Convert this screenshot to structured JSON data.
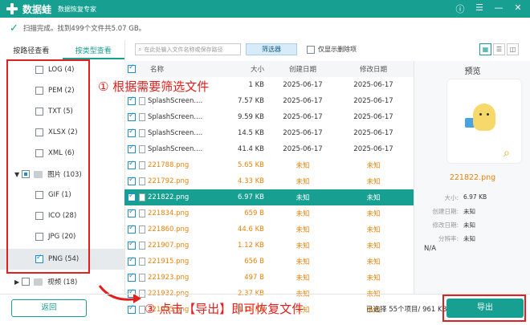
{
  "titlebar": {
    "app_name": "数据蛙",
    "subtitle": "数据恢复专家",
    "controls": [
      "ⓘ",
      "☰",
      "—",
      "✕"
    ]
  },
  "status": {
    "text": "扫描完成。找到499个文件共5.07 GB。"
  },
  "left_tabs": {
    "by_path": "按路径查看",
    "by_type": "按类型查看"
  },
  "tree": [
    {
      "label": "LOG (4)",
      "checked": false
    },
    {
      "label": "PEM (2)",
      "checked": false
    },
    {
      "label": "TXT (5)",
      "checked": false
    },
    {
      "label": "XLSX (2)",
      "checked": false
    },
    {
      "label": "XML (6)",
      "checked": false
    },
    {
      "label": "图片 (103)",
      "checked": "partial",
      "folder": true
    },
    {
      "label": "GIF (1)",
      "checked": false
    },
    {
      "label": "ICO (28)",
      "checked": false
    },
    {
      "label": "JPG (20)",
      "checked": false
    },
    {
      "label": "PNG (54)",
      "checked": true
    },
    {
      "label": "视频 (18)",
      "checked": false,
      "folder": true
    }
  ],
  "toolbar": {
    "search_placeholder": "在此处输入文件名称或保存路径",
    "filter_label": "筛选器",
    "only_deleted_label": "仅显示删除项"
  },
  "table": {
    "headers": {
      "name": "名称",
      "size": "大小",
      "created": "创建日期",
      "modified": "修改日期"
    },
    "rows": [
      {
        "name": "",
        "size": "1 KB",
        "created": "2025-06-17",
        "modified": "2025-06-17",
        "style": "normal"
      },
      {
        "name": "SplashScreen....",
        "size": "7.57 KB",
        "created": "2025-06-17",
        "modified": "2025-06-17",
        "style": "normal"
      },
      {
        "name": "SplashScreen....",
        "size": "9.59 KB",
        "created": "2025-06-17",
        "modified": "2025-06-17",
        "style": "normal"
      },
      {
        "name": "SplashScreen....",
        "size": "14.5 KB",
        "created": "2025-06-17",
        "modified": "2025-06-17",
        "style": "normal"
      },
      {
        "name": "SplashScreen....",
        "size": "41.4 KB",
        "created": "2025-06-17",
        "modified": "2025-06-17",
        "style": "normal"
      },
      {
        "name": "221788.png",
        "size": "5.65 KB",
        "created": "未知",
        "modified": "未知",
        "style": "orange"
      },
      {
        "name": "221792.png",
        "size": "4.33 KB",
        "created": "未知",
        "modified": "未知",
        "style": "orange"
      },
      {
        "name": "221822.png",
        "size": "6.97 KB",
        "created": "未知",
        "modified": "未知",
        "style": "hl"
      },
      {
        "name": "221834.png",
        "size": "659 B",
        "created": "未知",
        "modified": "未知",
        "style": "orange"
      },
      {
        "name": "221860.png",
        "size": "44.6 KB",
        "created": "未知",
        "modified": "未知",
        "style": "orange"
      },
      {
        "name": "221907.png",
        "size": "1.12 KB",
        "created": "未知",
        "modified": "未知",
        "style": "orange"
      },
      {
        "name": "221915.png",
        "size": "656 B",
        "created": "未知",
        "modified": "未知",
        "style": "orange"
      },
      {
        "name": "221923.png",
        "size": "497 B",
        "created": "未知",
        "modified": "未知",
        "style": "orange"
      },
      {
        "name": "221932.png",
        "size": "2.37 KB",
        "created": "未知",
        "modified": "未知",
        "style": "orange"
      },
      {
        "name": "221935.png",
        "size": "4.15 KB",
        "created": "未知",
        "modified": "未知",
        "style": "orange"
      }
    ]
  },
  "preview": {
    "title": "预览",
    "file_name": "221822.png",
    "meta": [
      {
        "k": "大小:",
        "v": "6.97 KB"
      },
      {
        "k": "创建日期:",
        "v": "未知"
      },
      {
        "k": "修改日期:",
        "v": "未知"
      },
      {
        "k": "分辨率:",
        "v": "未知"
      },
      {
        "k": "路径:",
        "v": ""
      }
    ],
    "path_value": "N/A"
  },
  "annotations": {
    "step1": "① 根据需要筛选文件",
    "step3": "③ 点击【导出】即可恢复文件"
  },
  "bottom": {
    "back_label": "返回",
    "selected_info": "已选择 55个项目/ 961 KB",
    "export_label": "导出"
  },
  "colors": {
    "brand": "#17a091",
    "annotation": "#e0201d",
    "orange": "#e8820c"
  }
}
